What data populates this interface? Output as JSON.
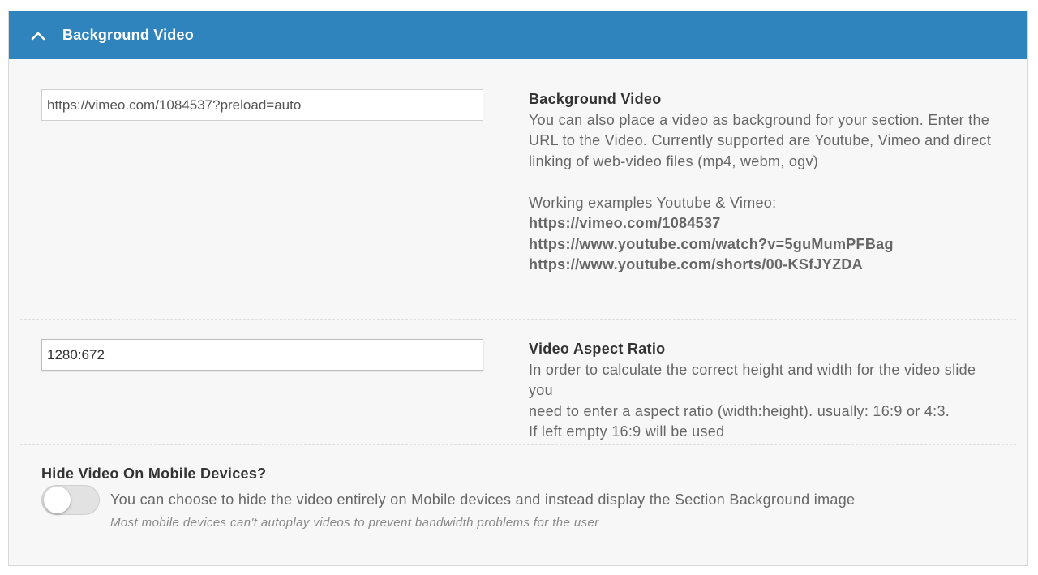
{
  "panel": {
    "title": "Background Video",
    "chevron_icon": "chevron-up-icon",
    "header_color": "#2f84bd"
  },
  "video_url": {
    "value": "https://vimeo.com/1084537?preload=auto",
    "label": "Background Video",
    "description": [
      "You can also place a video as background for your section. Enter the",
      "URL to the Video. Currently supported are Youtube, Vimeo and direct",
      "linking of web-video files (mp4, webm, ogv)"
    ],
    "examples_intro": "Working examples Youtube & Vimeo:",
    "examples": [
      "https://vimeo.com/1084537",
      "https://www.youtube.com/watch?v=5guMumPFBag",
      "https://www.youtube.com/shorts/00-KSfJYZDA"
    ]
  },
  "aspect_ratio": {
    "value": "1280:672",
    "label": "Video Aspect Ratio",
    "description": [
      "In order to calculate the correct height and width for the video slide you",
      "need to enter a aspect ratio (width:height). usually: 16:9 or 4:3.",
      "If left empty 16:9 will be used"
    ]
  },
  "mobile": {
    "label": "Hide Video On Mobile Devices?",
    "toggle_on": false,
    "description": "You can choose to hide the video entirely on Mobile devices and instead display the Section Background image",
    "note": "Most mobile devices can't autoplay videos to prevent bandwidth problems for the user"
  }
}
